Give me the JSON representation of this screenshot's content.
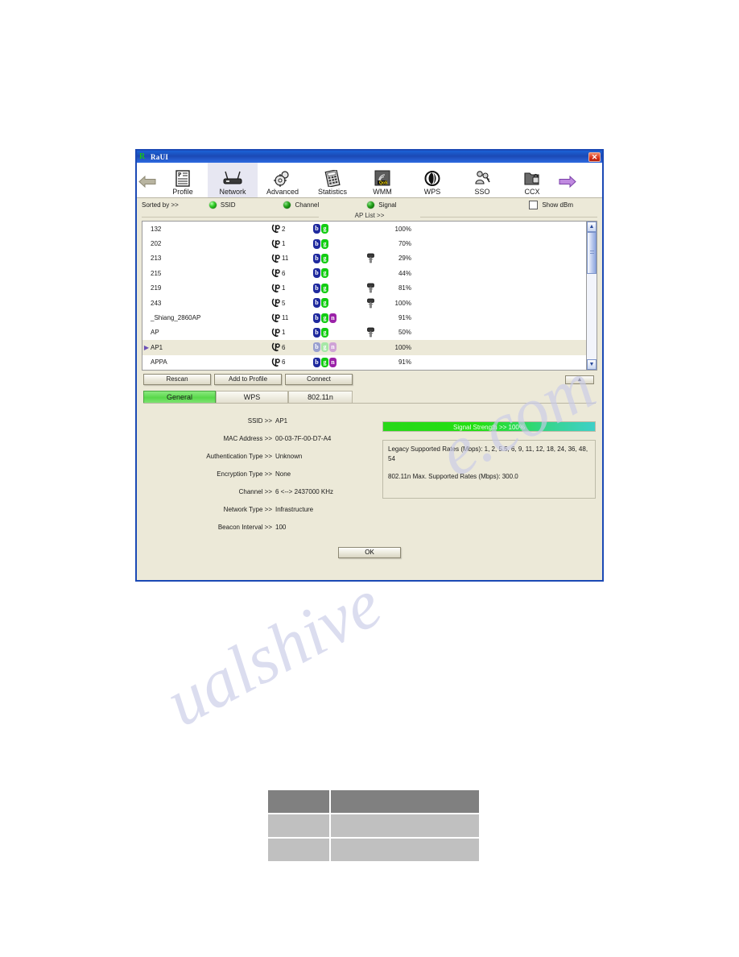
{
  "window": {
    "title": "RaUI",
    "logo_icon": "r-logo-icon",
    "close_label": "✕"
  },
  "toolbar": {
    "prev_icon": "left-arrow-icon",
    "next_icon": "right-arrow-icon",
    "tabs": [
      {
        "label": "Profile",
        "icon": "profile-document-icon",
        "active": false
      },
      {
        "label": "Network",
        "icon": "router-icon",
        "active": true
      },
      {
        "label": "Advanced",
        "icon": "gears-icon",
        "active": false
      },
      {
        "label": "Statistics",
        "icon": "calculator-icon",
        "active": false
      },
      {
        "label": "WMM",
        "icon": "qos-signal-icon",
        "active": false
      },
      {
        "label": "WPS",
        "icon": "wps-arrows-icon",
        "active": false
      },
      {
        "label": "SSO",
        "icon": "key-person-icon",
        "active": false
      },
      {
        "label": "CCX",
        "icon": "folder-lock-icon",
        "active": false
      }
    ]
  },
  "sortbar": {
    "label": "Sorted by >>",
    "options": [
      {
        "label": "SSID",
        "icon": "green-led-icon"
      },
      {
        "label": "Channel",
        "icon": "green-led-icon"
      },
      {
        "label": "Signal",
        "icon": "green-led-icon"
      }
    ],
    "show_dbm_label": "Show dBm",
    "show_dbm_checked": false
  },
  "ap_list": {
    "header": "AP List >>",
    "rows": [
      {
        "ssid": "132",
        "channel": "2",
        "badges": [
          "b",
          "g"
        ],
        "locked": false,
        "signal": "100%",
        "signal_value": 100,
        "selected": false
      },
      {
        "ssid": "202",
        "channel": "1",
        "badges": [
          "b",
          "g"
        ],
        "locked": false,
        "signal": "70%",
        "signal_value": 70,
        "selected": false
      },
      {
        "ssid": "213",
        "channel": "11",
        "badges": [
          "b",
          "g"
        ],
        "locked": true,
        "signal": "29%",
        "signal_value": 29,
        "selected": false
      },
      {
        "ssid": "215",
        "channel": "6",
        "badges": [
          "b",
          "g"
        ],
        "locked": false,
        "signal": "44%",
        "signal_value": 44,
        "selected": false
      },
      {
        "ssid": "219",
        "channel": "1",
        "badges": [
          "b",
          "g"
        ],
        "locked": true,
        "signal": "81%",
        "signal_value": 81,
        "selected": false
      },
      {
        "ssid": "243",
        "channel": "5",
        "badges": [
          "b",
          "g"
        ],
        "locked": true,
        "signal": "100%",
        "signal_value": 100,
        "selected": false
      },
      {
        "ssid": "_Shiang_2860AP",
        "channel": "11",
        "badges": [
          "b",
          "g",
          "n"
        ],
        "locked": false,
        "signal": "91%",
        "signal_value": 91,
        "selected": false
      },
      {
        "ssid": "AP",
        "channel": "1",
        "badges": [
          "b",
          "g"
        ],
        "locked": true,
        "signal": "50%",
        "signal_value": 50,
        "selected": false
      },
      {
        "ssid": "AP1",
        "channel": "6",
        "badges": [
          "b",
          "g",
          "n"
        ],
        "locked": false,
        "signal": "100%",
        "signal_value": 100,
        "selected": true
      },
      {
        "ssid": "APPA",
        "channel": "6",
        "badges": [
          "b",
          "g",
          "n"
        ],
        "locked": false,
        "signal": "91%",
        "signal_value": 91,
        "selected": false
      }
    ],
    "scroll_up_icon": "scroll-up-arrow-icon",
    "scroll_down_icon": "scroll-down-arrow-icon"
  },
  "actions": {
    "rescan": "Rescan",
    "add_to_profile": "Add to Profile",
    "connect": "Connect",
    "collapse_icon": "collapse-up-arrow-icon"
  },
  "detail": {
    "tabs": [
      {
        "label": "General",
        "active": true
      },
      {
        "label": "WPS",
        "active": false
      },
      {
        "label": "802.11n",
        "active": false
      }
    ],
    "fields": [
      {
        "key": "SSID >>",
        "value": "AP1"
      },
      {
        "key": "MAC Address >>",
        "value": "00-03-7F-00-D7-A4"
      },
      {
        "key": "Authentication Type >>",
        "value": "Unknown"
      },
      {
        "key": "Encryption Type >>",
        "value": "None"
      },
      {
        "key": "Channel >>",
        "value": "6 <--> 2437000 KHz"
      },
      {
        "key": "Network Type >>",
        "value": "Infrastructure"
      },
      {
        "key": "Beacon Interval >>",
        "value": "100"
      }
    ],
    "signal_strength_label": "Signal Strength >> 100%",
    "signal_strength_value": 100,
    "legacy_rates": "Legacy Supported Rates (Mbps): 1, 2, 5.5, 6, 9, 11, 12, 18, 24, 36, 48, 54",
    "n_rates": "802.11n Max. Supported Rates (Mbps): 300.0",
    "ok_label": "OK"
  },
  "bottom_table": {
    "rows": [
      {
        "cells": [
          "",
          ""
        ],
        "header": true
      },
      {
        "cells": [
          "",
          ""
        ],
        "header": false
      },
      {
        "cells": [
          "",
          ""
        ],
        "header": false
      }
    ]
  },
  "watermark": {
    "line1": "ualshive",
    "line2": "e.com"
  }
}
